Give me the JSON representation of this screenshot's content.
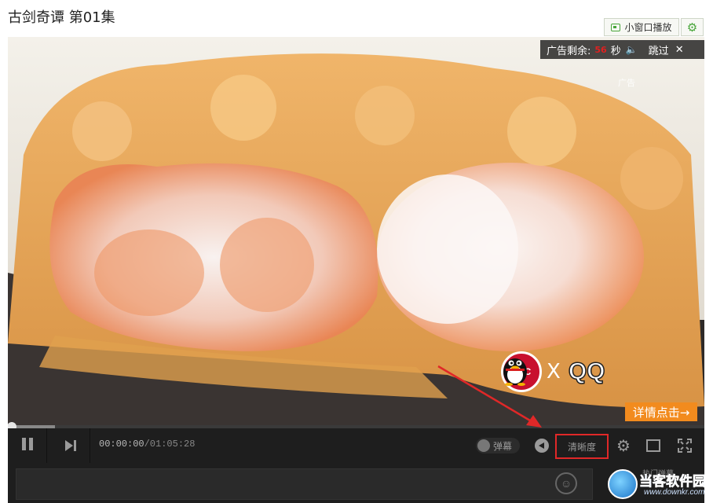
{
  "page": {
    "title": "古剑奇谭 第01集"
  },
  "toolbar": {
    "mini_window_label": "小窗口播放",
    "settings_icon": "gear-icon"
  },
  "ad": {
    "remaining_label": "广告剩余:",
    "countdown": "56",
    "seconds_label": "秒",
    "skip_label": "跳过",
    "ad_tag": "广告",
    "detail_label": "详情点击→",
    "brand_left": "KFC",
    "brand_times": "X",
    "brand_right": "QQ",
    "detail_color": "#f28b1e"
  },
  "player": {
    "current_time": "00:00:00",
    "total_time": "/01:05:28",
    "danmu_label": "弹幕",
    "quality_label": "清晰度",
    "progress_fraction": 0.0,
    "icons": [
      "pause-icon",
      "next-icon",
      "volume-icon",
      "gear-icon",
      "fit-screen-icon",
      "fullscreen-icon"
    ]
  },
  "danmu": {
    "hot_label": "热门弹幕"
  },
  "watermark": {
    "site": "当客软件园",
    "url": "www.downkr.com"
  },
  "colors": {
    "highlight": "#e02828",
    "accent_green": "#49a63b"
  }
}
